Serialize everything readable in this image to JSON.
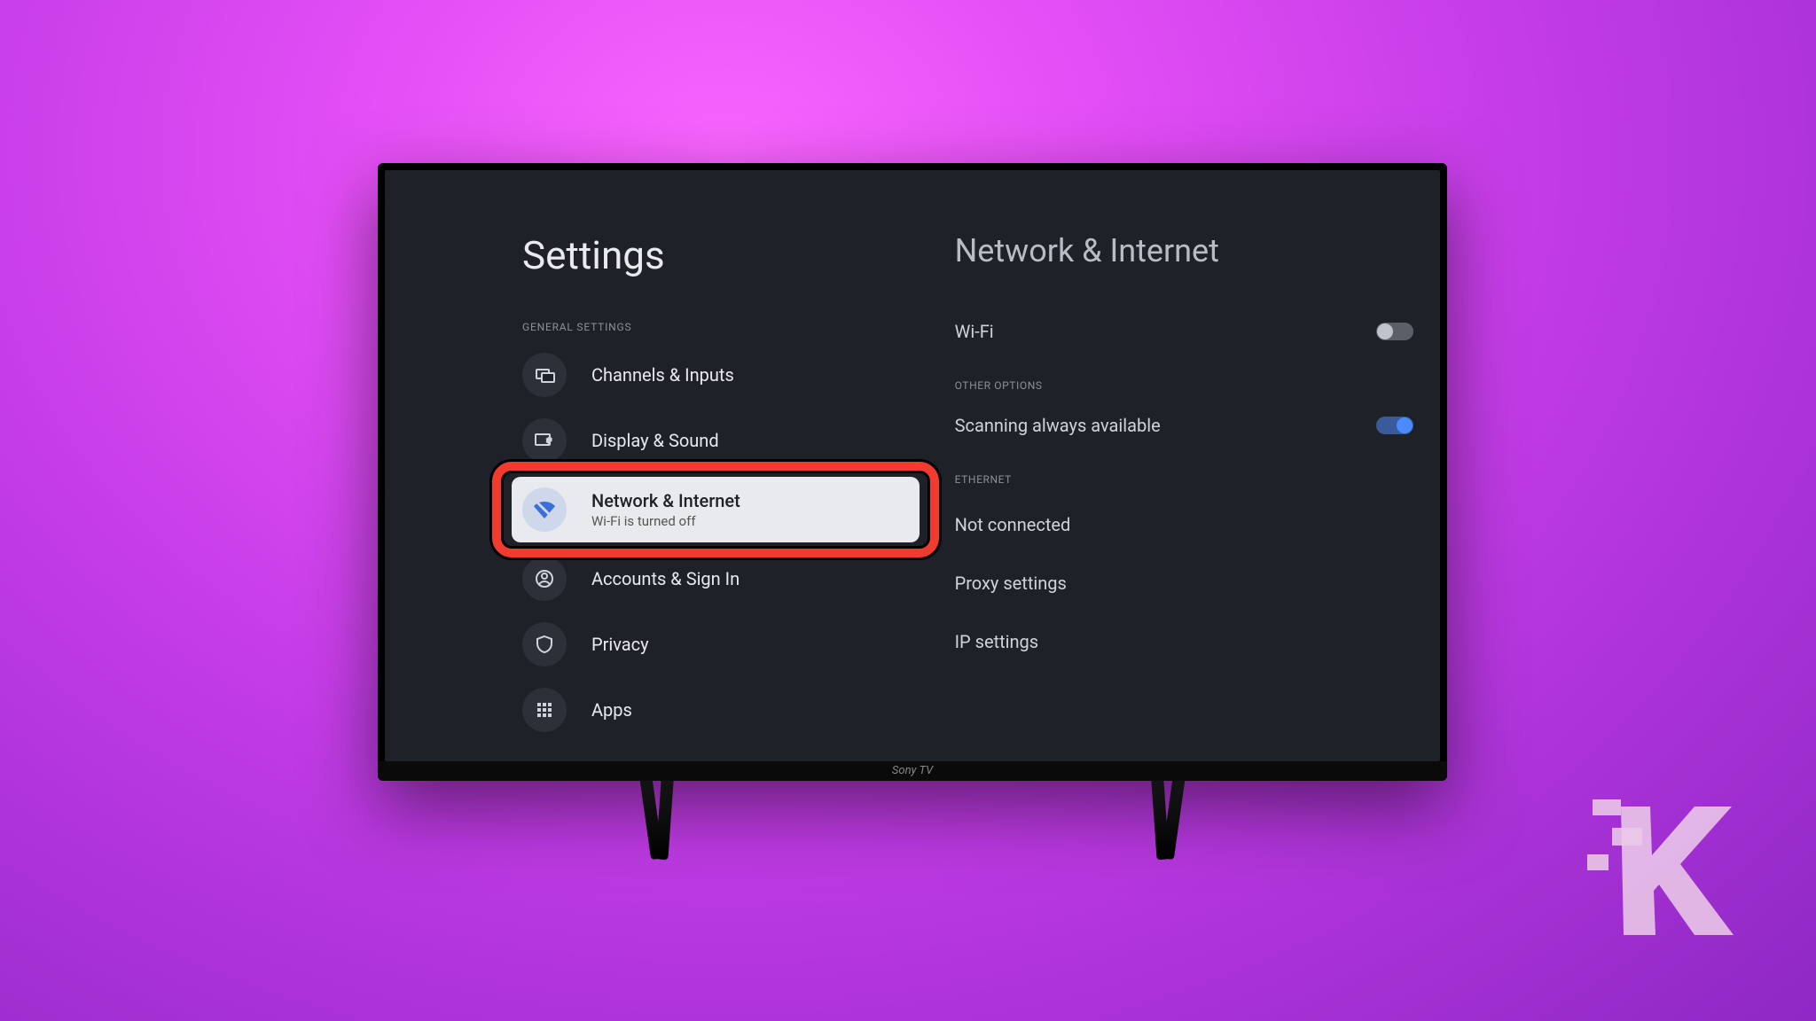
{
  "tv": {
    "brand_label": "Sony TV"
  },
  "sidebar": {
    "title": "Settings",
    "section_label": "GENERAL SETTINGS",
    "items": [
      {
        "label": "Channels & Inputs",
        "icon": "inputs-icon"
      },
      {
        "label": "Display & Sound",
        "icon": "display-sound-icon"
      },
      {
        "label": "Network & Internet",
        "subtitle": "Wi-Fi is turned off",
        "icon": "wifi-off-icon",
        "selected": true
      },
      {
        "label": "Accounts & Sign In",
        "icon": "account-icon"
      },
      {
        "label": "Privacy",
        "icon": "shield-icon"
      },
      {
        "label": "Apps",
        "icon": "apps-grid-icon"
      }
    ]
  },
  "detail": {
    "title": "Network & Internet",
    "wifi": {
      "label": "Wi-Fi",
      "toggle_on": false
    },
    "other_section": "OTHER OPTIONS",
    "scanning": {
      "label": "Scanning always available",
      "toggle_on": true
    },
    "ethernet_section": "ETHERNET",
    "ethernet_status": "Not connected",
    "proxy": "Proxy settings",
    "ip": "IP settings"
  }
}
